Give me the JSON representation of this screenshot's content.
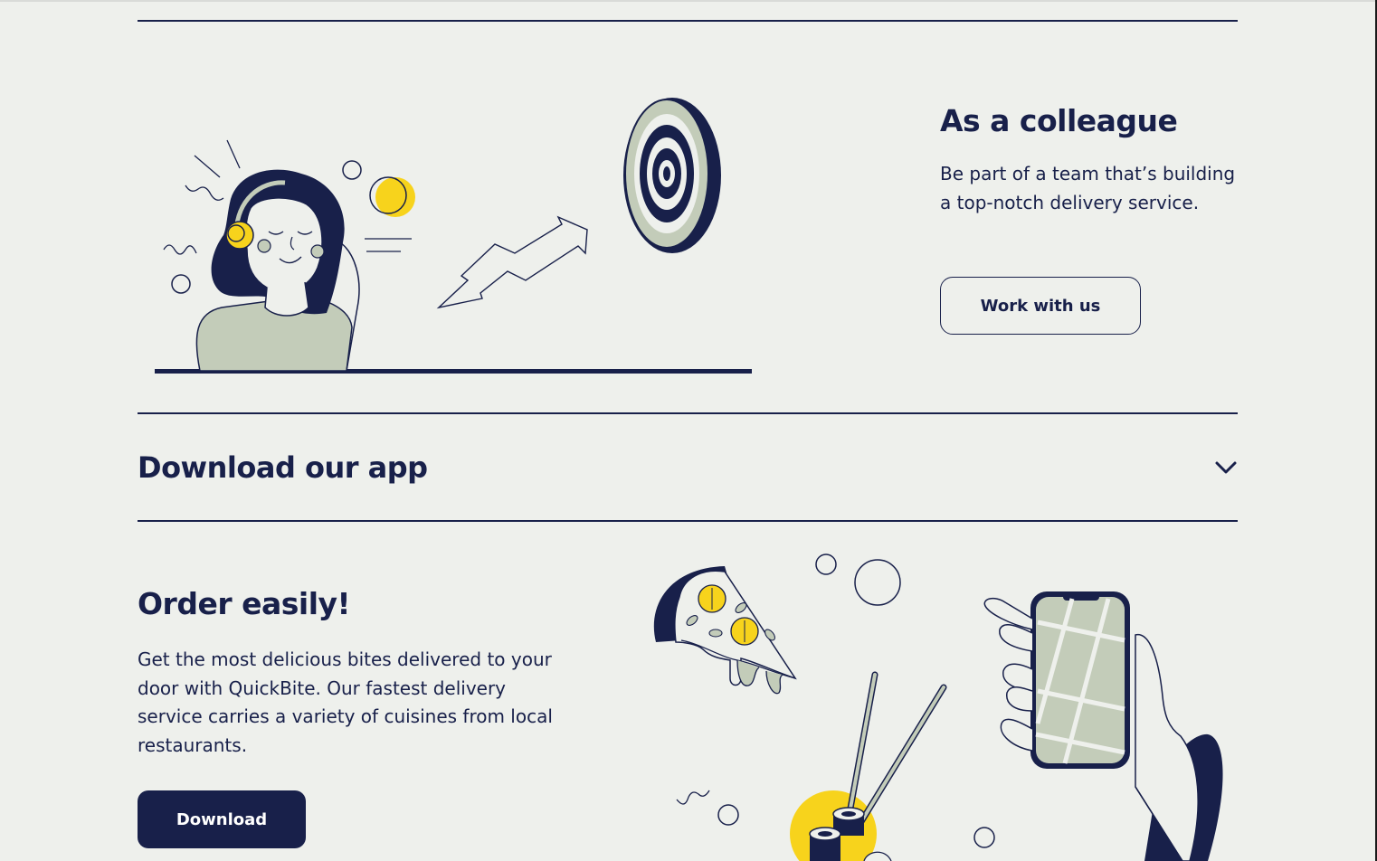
{
  "colleague": {
    "title": "As a colleague",
    "description": "Be part of a team that’s building a top-notch delivery service.",
    "button_label": "Work with us"
  },
  "download_section": {
    "title": "Download our app",
    "toggle_icon": "chevron-down-icon"
  },
  "order": {
    "title": "Order easily!",
    "description": "Get the most delicious bites delivered to your door with QuickBite. Our fastest delivery service carries a variety of cuisines from local restaurants.",
    "button_label": "Download"
  },
  "colors": {
    "navy": "#18204a",
    "background": "#eef0ec",
    "sage": "#c3ccb9",
    "yellow": "#f7d31c"
  }
}
